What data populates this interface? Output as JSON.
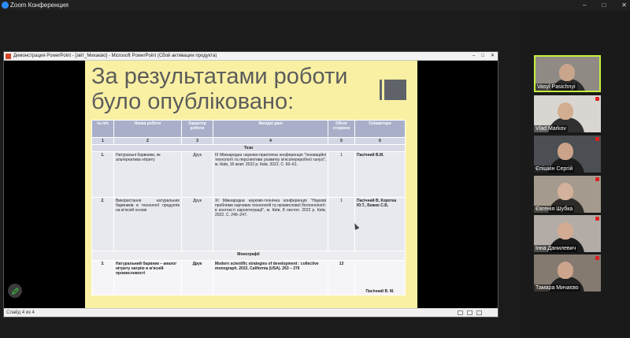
{
  "zoom": {
    "window_title": "Zoom Конференция",
    "window_controls": [
      "–",
      "□",
      "✕"
    ]
  },
  "ppt": {
    "window_title": "Демонстрация PowerPoint - [звіт_Михаєво] - Microsoft PowerPoint (Сбой активации продукта)",
    "window_controls": [
      "–",
      "□",
      "✕"
    ],
    "status_slide": "Слайд 4 из 4"
  },
  "slide": {
    "title": "За результатами роботи\nбуло опубліковано:",
    "table": {
      "headers": [
        "№ п/п",
        "Назва роботи",
        "Характер роботи",
        "Вихідні дані",
        "Обсяг сторінок",
        "Співавтори"
      ],
      "numbers": [
        "1",
        "2",
        "3",
        "4",
        "5",
        "6"
      ],
      "section1": "Тези",
      "rows": [
        {
          "num": "1.",
          "name": "Натуральні барвники, як альтернатива нітриту",
          "kind": "Друк",
          "source": "ІІІ Міжнародна науково-практична конференція \"Інноваційні технології та перспективи розвитку м'ясопереробної галузі\", м. Київ, 16 жовт. 2022 р. Київ, 2022. С. 60–61.",
          "pages": "1",
          "coauthors": "Пасічний В.М."
        },
        {
          "num": "2.",
          "name": "Використання натуральних барвників в технології продуктів на м'ясній основі",
          "kind": "Друк",
          "source": "ХІ Міжнародна науково-технічна конференція \"Наукові проблеми харчових технологій та промислової біотехнології: в контексті євроінтеграції\", м. Київ, 8 листоп. 2022 р. Київ, 2022. С. 246–247.",
          "pages": "1",
          "coauthors": "Пасічний В, Коротка Ю.Т., Божко С.Б."
        }
      ],
      "section2": "Монографії",
      "row3": {
        "num": "3.",
        "name": "Натуральний барвник – аналог нітриту натрію в м'ясній промисловості",
        "kind": "Друк",
        "source": "Modern scientific strategies of development : collective monograph. 2022, California (USA). 263 – 276",
        "pages": "13",
        "coauthors": "Пасічний В. М."
      }
    }
  },
  "participants": [
    {
      "name": "Vasyl Pasichnyi",
      "active": true,
      "bg": "#8f8a84",
      "skin": "#c9a58c",
      "cloth": "#2b2b2b"
    },
    {
      "name": "Vlad Markov",
      "active": false,
      "bg": "#d9d6d2",
      "skin": "#d2ad90",
      "cloth": "#303030"
    },
    {
      "name": "Єпішкін Сергій",
      "active": false,
      "bg": "#4b4e52",
      "skin": "#caa38a",
      "cloth": "#1c1c1c"
    },
    {
      "name": "Євгенія Шубка",
      "active": false,
      "bg": "#a59a8e",
      "skin": "#d3b19a",
      "cloth": "#2e2a27"
    },
    {
      "name": "Інна Данилевич",
      "active": false,
      "bg": "#b3aca6",
      "skin": "#d2ab92",
      "cloth": "#1b1b1b"
    },
    {
      "name": "Тамара Мичаєво",
      "active": false,
      "bg": "#857a70",
      "skin": "#cda58d",
      "cloth": "#222222"
    }
  ]
}
